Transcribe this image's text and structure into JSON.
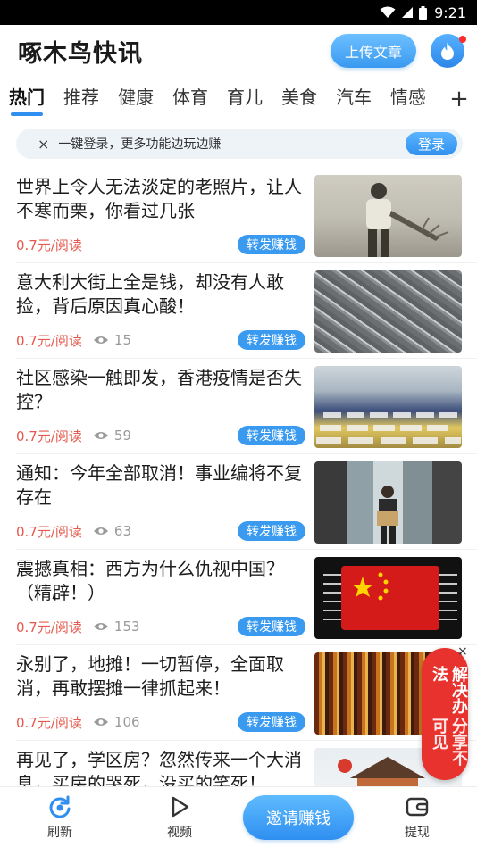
{
  "status_bar": {
    "time": "9:21"
  },
  "header": {
    "app_title": "啄木鸟快讯",
    "upload_label": "上传文章"
  },
  "tabs": [
    "热门",
    "推荐",
    "健康",
    "体育",
    "育儿",
    "美食",
    "汽车",
    "情感"
  ],
  "tab_add": "+",
  "login_banner": {
    "close": "×",
    "text": "一键登录，更多功能边玩边赚",
    "button": "登录"
  },
  "articles": [
    {
      "title": "世界上令人无法淡定的老照片，让人不寒而栗，你看过几张",
      "price": "0.7元/阅读",
      "views": "",
      "share": "转发赚钱"
    },
    {
      "title": "意大利大街上全是钱，却没有人敢捡，背后原因真心酸！",
      "price": "0.7元/阅读",
      "views": "15",
      "share": "转发赚钱"
    },
    {
      "title": "社区感染一触即发，香港疫情是否失控？",
      "price": "0.7元/阅读",
      "views": "59",
      "share": "转发赚钱"
    },
    {
      "title": "通知：今年全部取消！事业编将不复存在",
      "price": "0.7元/阅读",
      "views": "63",
      "share": "转发赚钱"
    },
    {
      "title": "震撼真相：西方为什么仇视中国？（精辟！）",
      "price": "0.7元/阅读",
      "views": "153",
      "share": "转发赚钱"
    },
    {
      "title": "永别了，地摊！一切暂停，全面取消，再敢摆摊一律抓起来！",
      "price": "0.7元/阅读",
      "views": "106",
      "share": "转发赚钱"
    },
    {
      "title": "再见了，学区房？忽然传来一个大消息，买房的哭死，没买的笑死！",
      "price": "",
      "views": "",
      "share": ""
    }
  ],
  "float_ad": {
    "col1": "分享不可见",
    "col2": "解决办法",
    "close": "×"
  },
  "bottom_nav": {
    "refresh": "刷新",
    "video": "视频",
    "invite": "邀请赚钱",
    "withdraw": "提现"
  },
  "colors": {
    "accent": "#2f8ff0",
    "price": "#e55a4e",
    "ad": "#e8322e"
  }
}
